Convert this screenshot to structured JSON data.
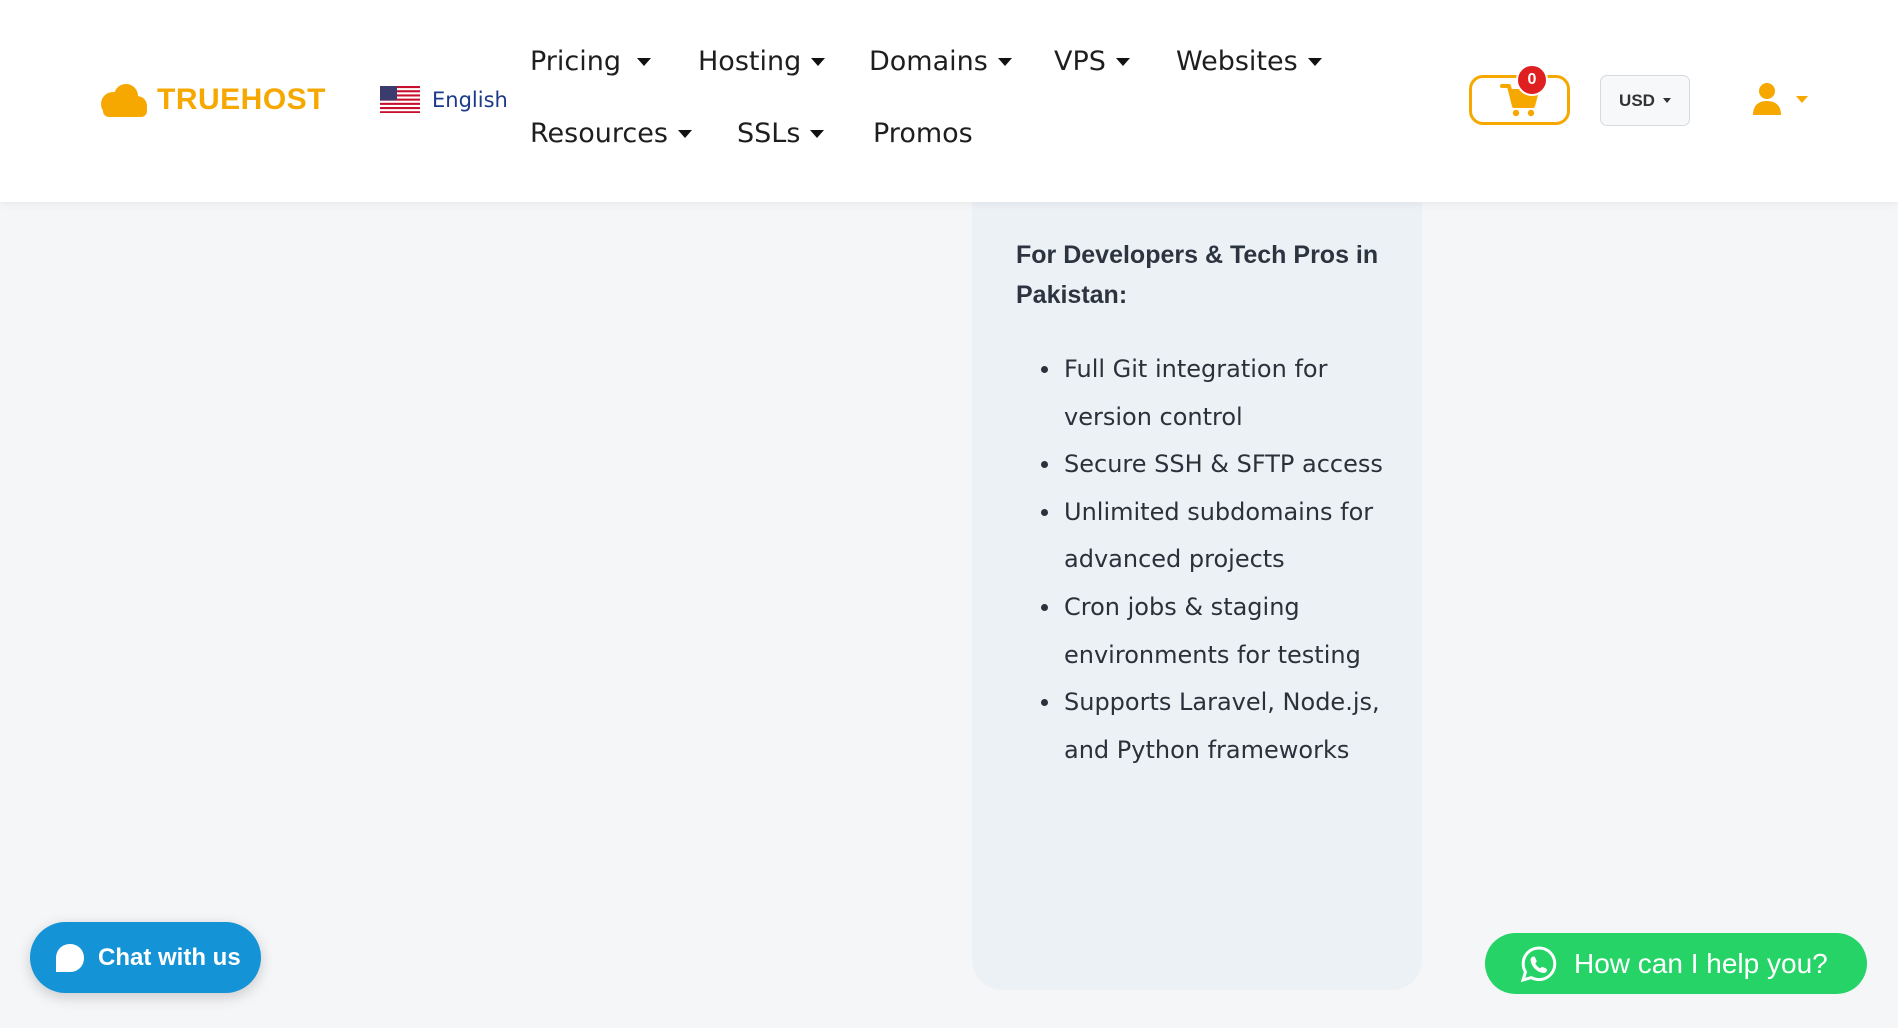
{
  "brand": {
    "name": "TRUEHOST",
    "color": "#f6a800"
  },
  "language": {
    "label": "English",
    "flag_icon": "us-flag-icon"
  },
  "nav": {
    "pricing": "Pricing",
    "hosting": "Hosting",
    "domains": "Domains",
    "vps": "VPS",
    "websites": "Websites",
    "resources": "Resources",
    "ssls": "SSLs",
    "promos": "Promos"
  },
  "cart": {
    "count": "0",
    "icon": "shopping-cart-icon"
  },
  "currency": {
    "selected": "USD"
  },
  "account": {
    "icon": "user-icon"
  },
  "feature_card": {
    "heading": "For Developers & Tech Pros in Pakistan:",
    "items": [
      "Full Git integration for version control",
      "Secure SSH & SFTP access",
      "Unlimited subdomains for advanced projects",
      "Cron jobs & staging environments for testing",
      "Supports Laravel, Node.js, and Python frameworks"
    ]
  },
  "chat_widget": {
    "label": "Chat with us",
    "color": "#1493d6"
  },
  "whatsapp_widget": {
    "label": "How can I help you?",
    "color": "#25d366"
  }
}
